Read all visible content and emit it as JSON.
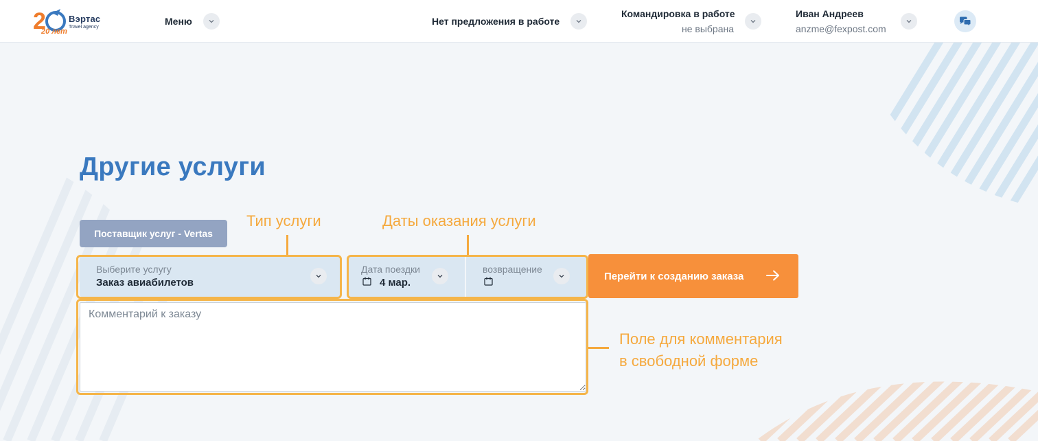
{
  "header": {
    "logo_mark_text": "20 лет",
    "logo_name": "Вэртас",
    "logo_tagline": "Travel agency",
    "menu_label": "Меню",
    "offer_status": "Нет предложения в работе",
    "trip_label": "Командировка в работе",
    "trip_value": "не выбрана",
    "user_name": "Иван Андреев",
    "user_email": "anzme@fexpost.com"
  },
  "main": {
    "title": "Другие услуги",
    "provider_button": "Поставщик услуг - Vertas",
    "service_select": {
      "caption": "Выберите услугу",
      "value": "Заказ авиабилетов"
    },
    "trip_date": {
      "caption": "Дата поездки",
      "value": "4 мар."
    },
    "return_date": {
      "caption": "возвращение",
      "value": ""
    },
    "submit_button": "Перейти к созданию заказа",
    "comment_placeholder": "Комментарий к заказу"
  },
  "annotations": {
    "service_type": "Тип услуги",
    "service_dates": "Даты оказания услуги",
    "comment_line_1": "Поле для комментария",
    "comment_line_2": "в свободной форме"
  },
  "colors": {
    "accent_blue": "#3a79bf",
    "cta_orange": "#f7903b",
    "annotation_orange": "#f5a93e",
    "field_background": "#dae7f2"
  }
}
